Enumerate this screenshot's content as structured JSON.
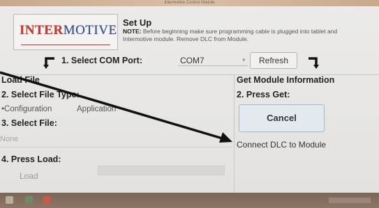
{
  "window": {
    "title": "Intermotive Control Module"
  },
  "header": {
    "logo_text_1": "INTER",
    "logo_text_2": "MOTIVE",
    "setup_title": "Set Up",
    "note_label": "NOTE:",
    "note_text": "Before beginning make sure programming cable is plugged into tablet and Intermotive module. Remove DLC from Module."
  },
  "com": {
    "label": "1. Select COM Port:",
    "value": "COM7",
    "refresh_label": "Refresh"
  },
  "load_panel": {
    "title": "Load File",
    "step2": "2. Select File Type:",
    "opt_configuration": "Configuration",
    "opt_application": "Application",
    "step3": "3. Select File:",
    "file_value": "None",
    "step4": "4. Press Load:",
    "load_label": "Load"
  },
  "get_panel": {
    "title": "Get Module Information",
    "step2": "2. Press Get:",
    "cancel_label": "Cancel",
    "status": "Connect DLC to Module"
  }
}
